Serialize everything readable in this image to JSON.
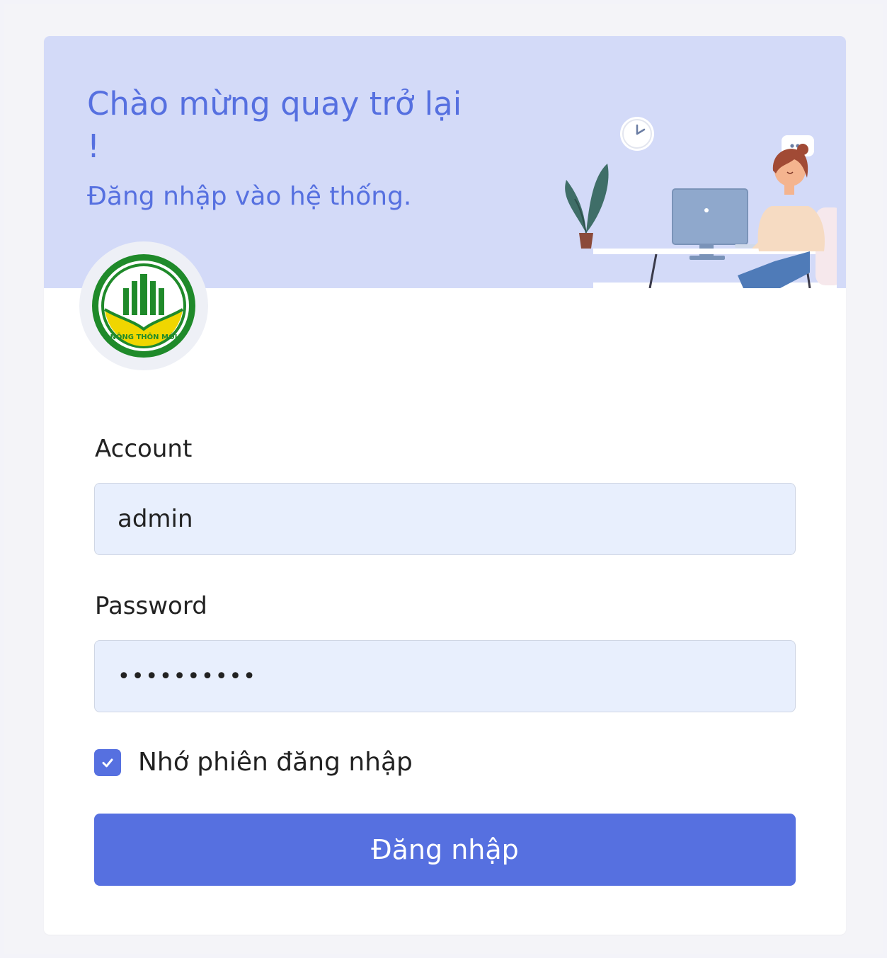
{
  "hero": {
    "title": "Chào mừng quay trở lại !",
    "subtitle": "Đăng nhập vào hệ thống.",
    "illustration_icon": "person-at-desk-illustration"
  },
  "logo": {
    "icon": "nong-thon-moi-logo",
    "text": "NÔNG THÔN MỚI"
  },
  "form": {
    "account_label": "Account",
    "account_value": "admin",
    "password_label": "Password",
    "password_value": "••••••••••",
    "remember_label": "Nhớ phiên đăng nhập",
    "remember_checked": true,
    "submit_label": "Đăng nhập"
  },
  "colors": {
    "accent": "#5670e0",
    "hero_bg": "#d3daf8",
    "input_bg": "#e8effd",
    "logo_green": "#1f8a2a",
    "logo_yellow": "#f0d600"
  }
}
